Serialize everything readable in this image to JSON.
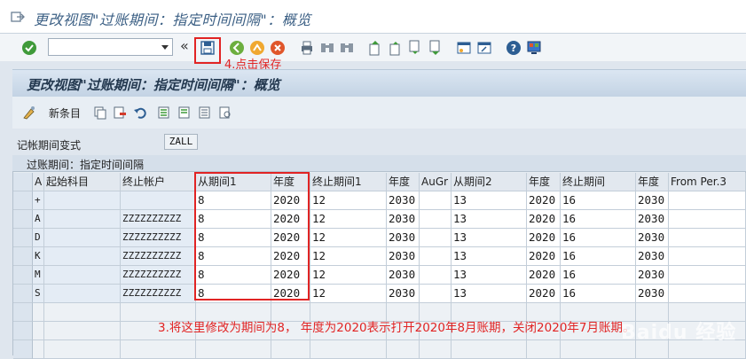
{
  "window": {
    "title": "更改视图\"过账期间：指定时间间隔\"：概览",
    "subtitle": "更改视图\"过账期间：指定时间间隔\"：概览"
  },
  "toolbar": {
    "command_value": "",
    "icons": [
      "enter-icon",
      "save-icon",
      "back-icon",
      "exit-icon",
      "cancel-icon",
      "print-icon",
      "find-icon",
      "find-next-icon",
      "first-page-icon",
      "previous-page-icon",
      "next-page-icon",
      "last-page-icon",
      "new-session-icon",
      "shortcut-icon",
      "help-icon",
      "layout-icon"
    ]
  },
  "annotations": {
    "save": "4.点击保存",
    "main": "3.将这里修改为期间为8， 年度为2020表示打开2020年8月账期，关闭2020年7月账期。",
    "watermark": "Baidu 经验"
  },
  "apptoolbar": {
    "new_entries": "新条目"
  },
  "variant": {
    "label": "记帐期间变式",
    "value": "ZALL"
  },
  "table": {
    "title": "过账期间：指定时间间隔",
    "headers": [
      "A",
      "起始科目",
      "终止帐户",
      "从期间1",
      "年度",
      "终止期间1",
      "年度",
      "AuGr",
      "从期间2",
      "年度",
      "终止期间",
      "年度",
      "From Per.3"
    ],
    "rows": [
      [
        "+",
        "",
        "",
        "8",
        "2020",
        "12",
        "2030",
        "",
        "13",
        "2020",
        "16",
        "2030",
        ""
      ],
      [
        "A",
        "",
        "ZZZZZZZZZZ",
        "8",
        "2020",
        "12",
        "2030",
        "",
        "13",
        "2020",
        "16",
        "2030",
        ""
      ],
      [
        "D",
        "",
        "ZZZZZZZZZZ",
        "8",
        "2020",
        "12",
        "2030",
        "",
        "13",
        "2020",
        "16",
        "2030",
        ""
      ],
      [
        "K",
        "",
        "ZZZZZZZZZZ",
        "8",
        "2020",
        "12",
        "2030",
        "",
        "13",
        "2020",
        "16",
        "2030",
        ""
      ],
      [
        "M",
        "",
        "ZZZZZZZZZZ",
        "8",
        "2020",
        "12",
        "2030",
        "",
        "13",
        "2020",
        "16",
        "2030",
        ""
      ],
      [
        "S",
        "",
        "ZZZZZZZZZZ",
        "8",
        "2020",
        "12",
        "2030",
        "",
        "13",
        "2020",
        "16",
        "2030",
        ""
      ]
    ]
  },
  "colors": {
    "accent_red": "#e12424",
    "title_blue": "#3b5f84"
  }
}
